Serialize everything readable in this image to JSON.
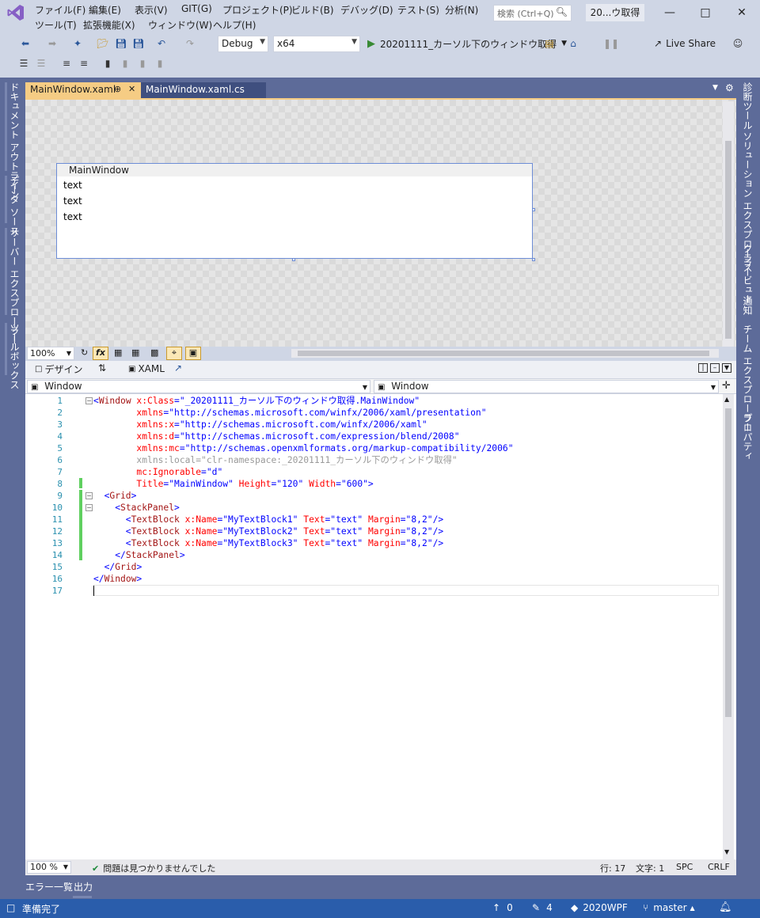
{
  "menu": {
    "row1": [
      "ファイル(F)",
      "編集(E)",
      "表示(V)",
      "GIT(G)",
      "プロジェクト(P)",
      "ビルド(B)",
      "デバッグ(D)",
      "テスト(S)",
      "分析(N)"
    ],
    "row2": [
      "ツール(T)",
      "拡張機能(X)",
      "ウィンドウ(W)",
      "ヘルプ(H)"
    ]
  },
  "search": {
    "placeholder": "検索 (Ctrl+Q)"
  },
  "solution_name": "20...ウ取得",
  "toolbar": {
    "config": "Debug",
    "platform": "x64",
    "run_target": "20201111_カーソル下のウィンドウ取得",
    "live_share": "Live Share"
  },
  "left_rail": [
    "ドキュメント アウトライン",
    "データ ソース",
    "サーバー エクスプローラー",
    "ツールボックス"
  ],
  "right_rail": [
    "診断ツール",
    "ソリューション エクスプローラー",
    "クラス ビュー",
    "通知",
    "チーム エクスプローラー",
    "プロパティ"
  ],
  "doc_tabs": [
    {
      "label": "MainWindow.xaml",
      "active": true,
      "pinned": true
    },
    {
      "label": "MainWindow.xaml.cs",
      "active": false
    }
  ],
  "designer": {
    "window_title": "MainWindow",
    "texts": [
      "text",
      "text",
      "text"
    ],
    "zoom": "100%"
  },
  "pane_tabs": {
    "design": "デザイン",
    "xaml": "XAML"
  },
  "nav": {
    "left": "Window",
    "right": "Window"
  },
  "code": {
    "line_numbers": [
      "1",
      "2",
      "3",
      "4",
      "5",
      "6",
      "7",
      "8",
      "9",
      "10",
      "11",
      "12",
      "13",
      "14",
      "15",
      "16",
      "17"
    ]
  },
  "editor_status": {
    "zoom": "100 %",
    "issues": "問題は見つかりませんでした",
    "line": "行: 17",
    "char": "文字: 1",
    "spc": "SPC",
    "crlf": "CRLF"
  },
  "output_tabs": [
    "エラー一覧",
    "出力"
  ],
  "statusbar": {
    "ready": "準備完了",
    "up": "0",
    "edits": "4",
    "repo": "2020WPF",
    "branch": "master"
  },
  "colors": {
    "accent": "#2a5dab",
    "chrome": "#5d6b99",
    "active_tab": "#f5cc84",
    "changed": "#60d060"
  }
}
